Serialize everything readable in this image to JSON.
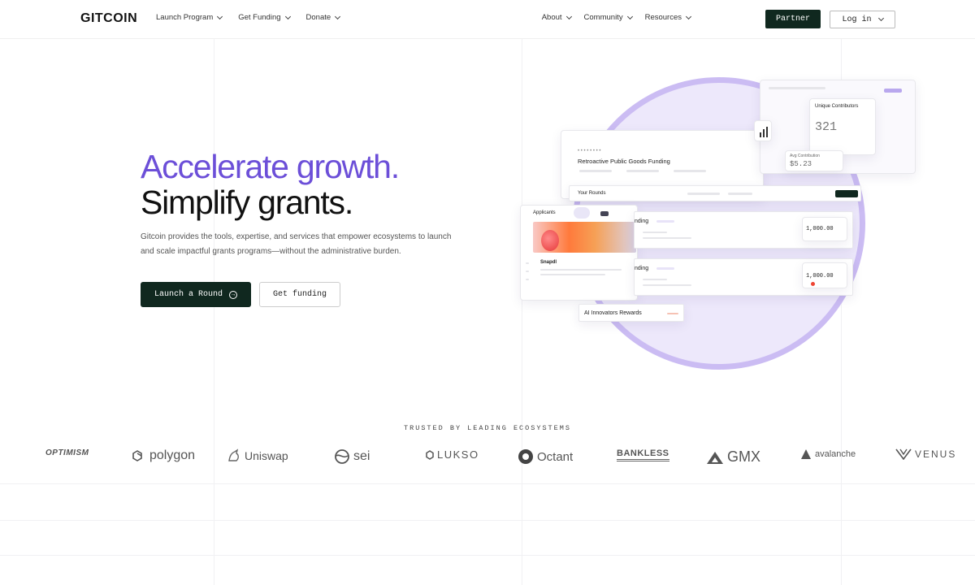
{
  "header": {
    "logo": "GITCOIN",
    "nav_left": [
      "Launch Program",
      "Get Funding",
      "Donate"
    ],
    "nav_right": [
      "About",
      "Community",
      "Resources"
    ],
    "partner_label": "Partner",
    "login_label": "Log in"
  },
  "hero": {
    "headline_accent": "Accelerate growth.",
    "headline_main": "Simplify grants.",
    "description": "Gitcoin provides the tools, expertise, and services that empower ecosystems to launch and scale impactful grants programs—without the administrative burden.",
    "primary_cta": "Launch a Round",
    "secondary_cta": "Get funding"
  },
  "illustration": {
    "round_card_title": "Retroactive Public Goods Funding",
    "unique_contributors_label": "Unique Contributors",
    "unique_contributors_value": "321",
    "avg_contribution_label": "Avg Contribution",
    "avg_contribution_value": "$5.23",
    "your_rounds_label": "Your Rounds",
    "applicants_label": "Applicants",
    "project_name": "Snapdl",
    "funding_label_1": "nding",
    "funding_label_2": "nding",
    "amount_1": "1,000.00",
    "amount_2": "1,000.00",
    "ai_rewards": "AI Innovators Rewards"
  },
  "trusted": {
    "label": "TRUSTED BY LEADING ECOSYSTEMS",
    "brands": [
      "OPTIMISM",
      "polygon",
      "Uniswap",
      "sei",
      "LUKSO",
      "Octant",
      "BANKLESS",
      "GMX",
      "avalanche",
      "VENUS"
    ]
  },
  "colors": {
    "accent": "#6c4fd8",
    "dark": "#10281f",
    "blob": "#ede8fb"
  }
}
